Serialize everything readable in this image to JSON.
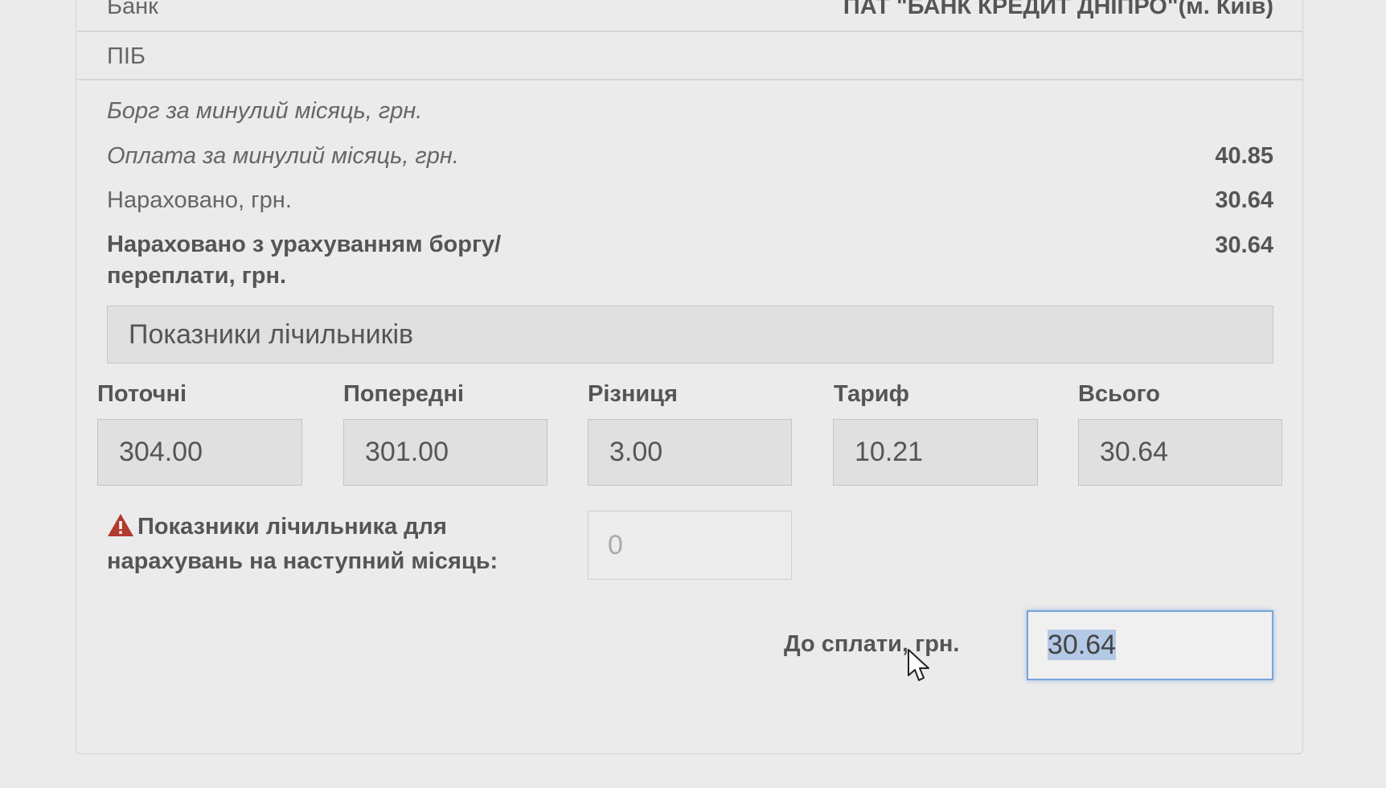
{
  "bank": {
    "label": "Банк",
    "value": "ПАТ \"БАНК КРЕДИТ ДНІПРО\"(м. Київ)"
  },
  "pib": {
    "label": "ПІБ"
  },
  "debt_prev_month": {
    "label": "Борг за минулий місяць, грн."
  },
  "payment_prev_month": {
    "label": "Оплата за минулий місяць, грн.",
    "value": "40.85"
  },
  "accrued": {
    "label": "Нараховано, грн.",
    "value": "30.64"
  },
  "accrued_with_debt": {
    "label_line1": "Нараховано з урахуванням боргу/",
    "label_line2": "переплати, грн.",
    "value": "30.64"
  },
  "meters": {
    "title": "Показники лічильників",
    "current": {
      "label": "Поточні",
      "value": "304.00"
    },
    "previous": {
      "label": "Попередні",
      "value": "301.00"
    },
    "difference": {
      "label": "Різниця",
      "value": "3.00"
    },
    "tariff": {
      "label": "Тариф",
      "value": "10.21"
    },
    "total": {
      "label": "Всього",
      "value": "30.64"
    }
  },
  "next_month": {
    "label_line1": "Показники лічильника для",
    "label_line2": "нарахувань на наступний місяць:",
    "placeholder": "0",
    "icon": "warning-icon"
  },
  "to_pay": {
    "label": "До сплати, грн.",
    "value": "30.64"
  },
  "colors": {
    "warning": "#b33a2e",
    "focus_border": "#78a3d8",
    "selection": "#b4c9e6"
  }
}
